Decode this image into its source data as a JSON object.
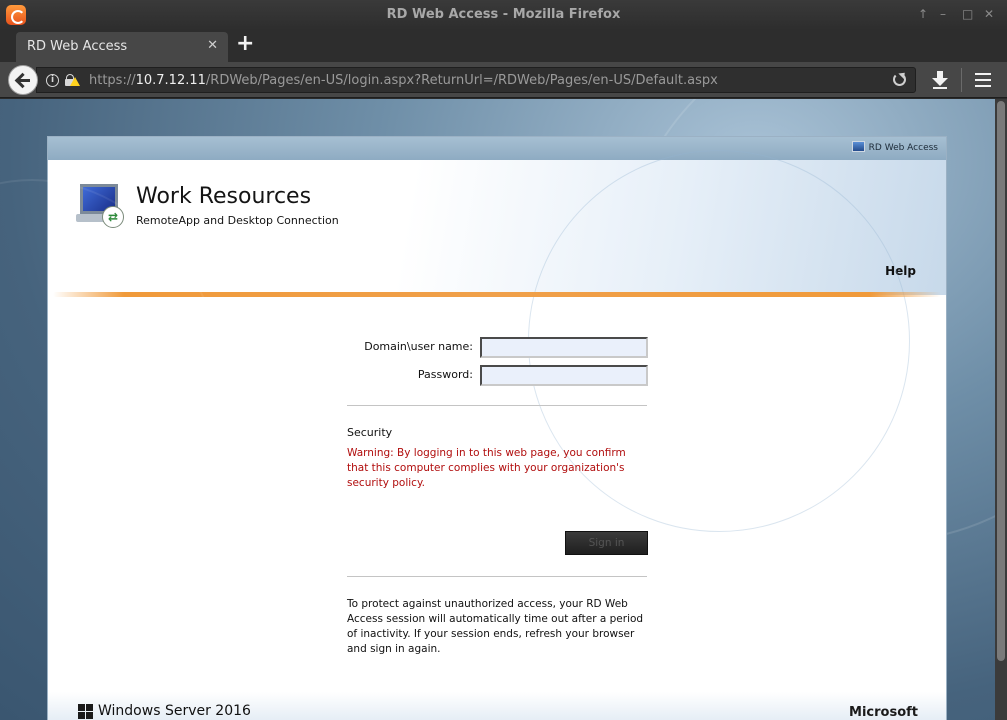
{
  "window": {
    "title": "RD Web Access - Mozilla Firefox",
    "controls": [
      "↑",
      "–",
      "□",
      "✕"
    ]
  },
  "tabs": [
    {
      "label": "RD Web Access",
      "close": "✕"
    }
  ],
  "new_tab_label": "+",
  "url": {
    "scheme": "https://",
    "host": "10.7.12.11",
    "path": "/RDWeb/Pages/en-US/login.aspx?ReturnUrl=/RDWeb/Pages/en-US/Default.aspx"
  },
  "icons": {
    "info": "info-icon",
    "lock": "lock-icon",
    "warning": "warning-icon",
    "reload": "reload-icon",
    "download": "download-icon",
    "menu": "hamburger-menu-icon"
  },
  "page": {
    "top_badge": "RD Web Access",
    "title": "Work Resources",
    "subtitle": "RemoteApp and Desktop Connection",
    "help": "Help",
    "form": {
      "username_label": "Domain\\user name:",
      "username_value": "",
      "password_label": "Password:",
      "password_value": ""
    },
    "security_title": "Security",
    "security_warning": "Warning: By logging in to this web page, you confirm that this computer complies with your organization's security policy.",
    "sign_in": "Sign in",
    "timeout_notice": "To protect against unauthorized access, your RD Web Access session will automatically time out after a period of inactivity. If your session ends, refresh your browser and sign in again.",
    "footer_left": "Windows Server 2016",
    "footer_right": "Microsoft"
  },
  "colors": {
    "accent_orange": "#f09a3a",
    "warning_red": "#b10d0d",
    "browser_chrome": "#474747"
  }
}
